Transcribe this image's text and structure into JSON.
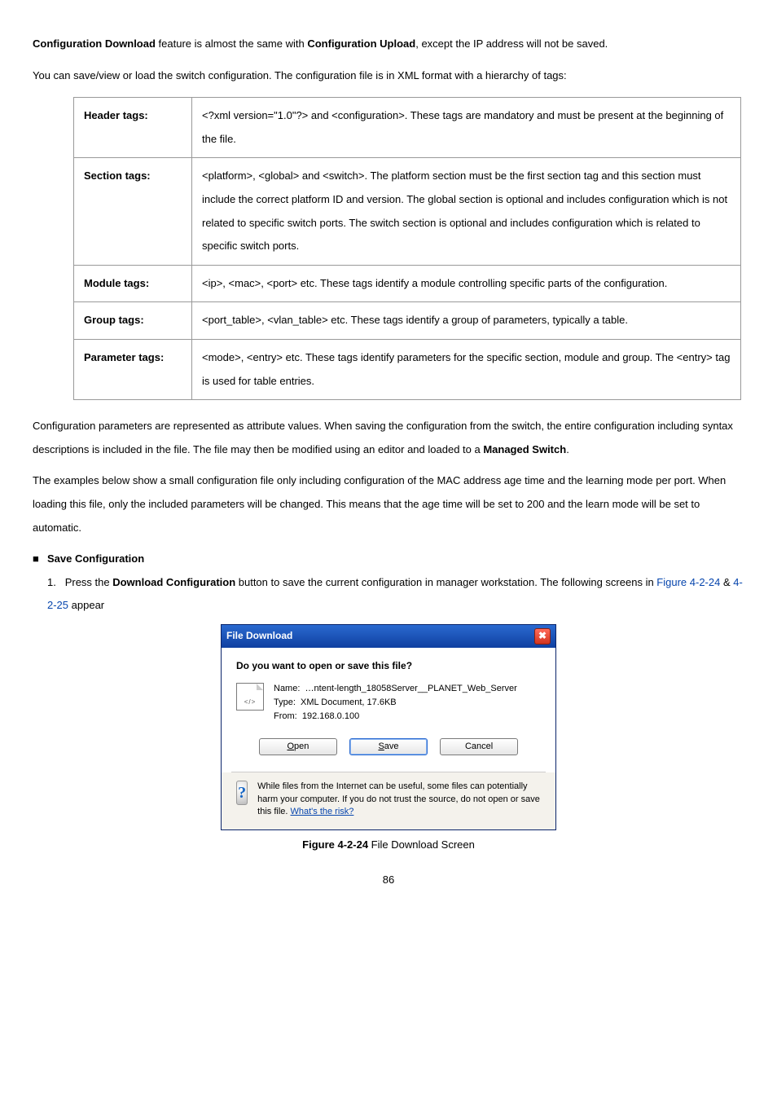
{
  "intro": {
    "line1_a": "Configuration Download",
    "line1_b": " feature is almost the same with ",
    "line1_c": "Configuration Upload",
    "line1_d": ", except the IP address will not be saved.",
    "line2": "You can save/view or load the switch configuration. The configuration file is in XML format with a hierarchy of tags:"
  },
  "table": [
    {
      "k": "Header tags:",
      "v": "<?xml version=\"1.0\"?> and <configuration>. These tags are mandatory and must be present at the beginning of the file."
    },
    {
      "k": "Section tags:",
      "v": "<platform>, <global> and <switch>. The platform section must be the first section tag and this section must include the correct platform ID and version. The global section is optional and includes configuration which is not related to specific switch ports. The switch section is optional and includes configuration which is related to specific switch ports."
    },
    {
      "k": "Module tags:",
      "v": "<ip>, <mac>, <port> etc. These tags identify a module controlling specific parts of the configuration."
    },
    {
      "k": "Group tags:",
      "v": "<port_table>, <vlan_table> etc. These tags identify a group of parameters, typically a table."
    },
    {
      "k": "Parameter tags:",
      "v": "<mode>, <entry> etc. These tags identify parameters for the specific section, module and group. The <entry> tag is used for table entries."
    }
  ],
  "after": {
    "p1": "Configuration parameters are represented as attribute values. When saving the configuration from the switch, the entire configuration including syntax descriptions is included in the file. The file may then be modified using an editor and loaded to a ",
    "p1b": "Managed Switch",
    "p1c": ".",
    "p2": "The examples below show a small configuration file only including configuration of the MAC address age time and the learning mode per port. When loading this file, only the included parameters will be changed. This means that the age time will be set to 200 and the learn mode will be set to automatic."
  },
  "save_section": {
    "heading": "Save Configuration",
    "step_pre": "Press the ",
    "button_label": "Download Configuration",
    "step_post": " button to save the current configuration in manager workstation. The following screens in ",
    "fig1": "Figure 4-2-24",
    "amp": " & ",
    "fig2": "4-2-25",
    "appear": " appear"
  },
  "dialog": {
    "title": "File Download",
    "question": "Do you want to open or save this file?",
    "meta_name_label": "Name:",
    "meta_name_value": "…ntent-length_18058Server__PLANET_Web_Server",
    "meta_type_label": "Type:",
    "meta_type_value": "XML Document, 17.6KB",
    "meta_from_label": "From:",
    "meta_from_value": "192.168.0.100",
    "btn_open": "Open",
    "btn_save": "Save",
    "btn_cancel": "Cancel",
    "warn_text": "While files from the Internet can be useful, some files can potentially harm your computer. If you do not trust the source, do not open or save this file. ",
    "warn_link": "What's the risk?"
  },
  "figure_caption_pre": "Figure 4-2-24",
  "figure_caption_post": " File Download Screen",
  "page_number": "86"
}
